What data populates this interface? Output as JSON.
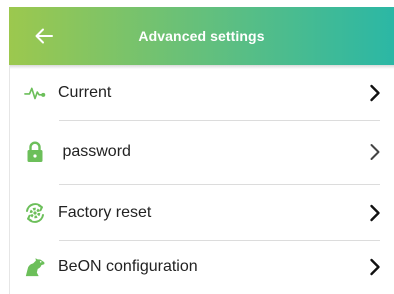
{
  "header": {
    "title": "Advanced settings",
    "back_icon": "arrow-left-icon",
    "gradient_start": "#9cc84e",
    "gradient_end": "#2bb7a5"
  },
  "menu": {
    "items": [
      {
        "label": "Current",
        "icon": "pulse-icon",
        "icon_color": "#6cbf5a"
      },
      {
        "label": " password",
        "icon": "lock-icon",
        "icon_color": "#6cbf5a"
      },
      {
        "label": "Factory reset",
        "icon": "reset-gear-icon",
        "icon_color": "#6cbf5a"
      },
      {
        "label": "BeON configuration",
        "icon": "dog-icon",
        "icon_color": "#6cbf5a"
      }
    ],
    "chevron_icon": "chevron-right-icon"
  }
}
